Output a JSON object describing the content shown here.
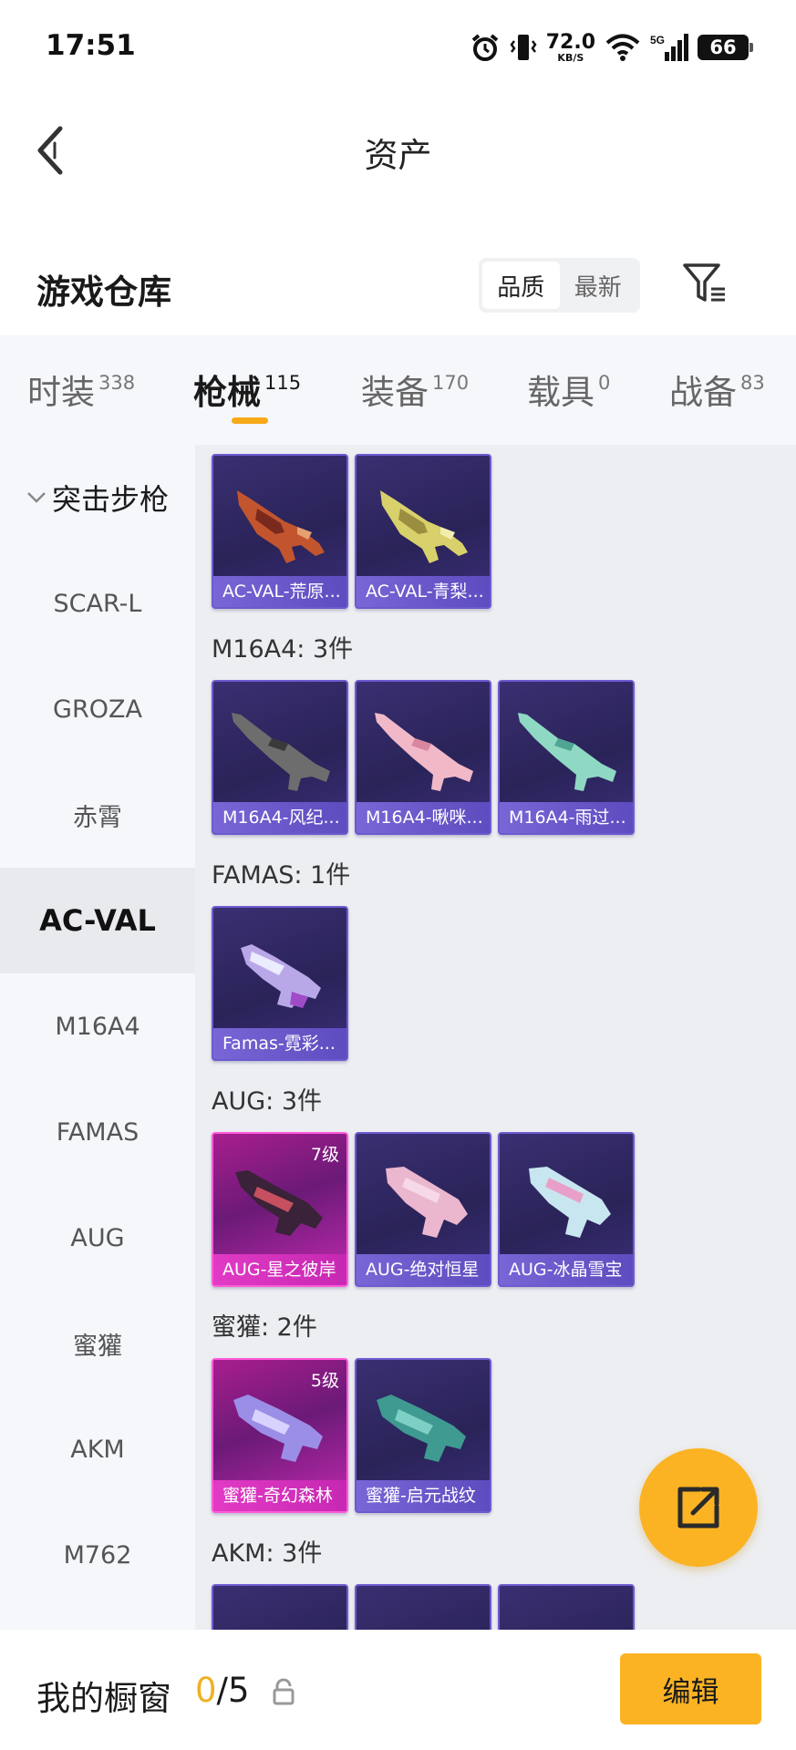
{
  "status_bar": {
    "time": "17:51",
    "net_speed": "72.0",
    "net_unit": "KB/S",
    "signal_label": "5G",
    "battery": "66"
  },
  "header": {
    "title": "资产"
  },
  "warehouse": {
    "title": "游戏仓库",
    "sort_options": [
      "品质",
      "最新"
    ],
    "active_sort": "品质"
  },
  "tabs": [
    {
      "label": "时装",
      "count": "338"
    },
    {
      "label": "枪械",
      "count": "115"
    },
    {
      "label": "装备",
      "count": "170"
    },
    {
      "label": "载具",
      "count": "0"
    },
    {
      "label": "战备",
      "count": "83"
    }
  ],
  "active_tab": "枪械",
  "sidebar": {
    "group": "突击步枪",
    "items": [
      "SCAR-L",
      "GROZA",
      "赤霄",
      "AC-VAL",
      "M16A4",
      "FAMAS",
      "AUG",
      "蜜獾",
      "AKM",
      "M762"
    ],
    "active": "AC-VAL"
  },
  "content": {
    "groups": [
      {
        "label": "",
        "items": [
          {
            "name": "AC-VAL-荒原...",
            "level": ""
          },
          {
            "name": "AC-VAL-青梨...",
            "level": ""
          }
        ]
      },
      {
        "label": "M16A4: 3件",
        "items": [
          {
            "name": "M16A4-风纪...",
            "level": ""
          },
          {
            "name": "M16A4-啾咪...",
            "level": ""
          },
          {
            "name": "M16A4-雨过...",
            "level": ""
          }
        ]
      },
      {
        "label": "FAMAS: 1件",
        "items": [
          {
            "name": "Famas-霓彩...",
            "level": ""
          }
        ]
      },
      {
        "label": "AUG: 3件",
        "items": [
          {
            "name": "AUG-星之彼岸",
            "level": "7级"
          },
          {
            "name": "AUG-绝对恒星",
            "level": ""
          },
          {
            "name": "AUG-冰晶雪宝",
            "level": ""
          }
        ]
      },
      {
        "label": "蜜獾: 2件",
        "items": [
          {
            "name": "蜜獾-奇幻森林",
            "level": "5级"
          },
          {
            "name": "蜜獾-启元战纹",
            "level": ""
          }
        ]
      },
      {
        "label": "AKM: 3件",
        "items": []
      }
    ]
  },
  "bottom": {
    "showcase_label": "我的橱窗",
    "showcase_current": "0",
    "showcase_total": "/5",
    "edit_label": "编辑"
  },
  "colors": {
    "accent": "#fbb324",
    "card_purple": "#2a2358",
    "card_pink": "#a81e8f",
    "tab_indicator": "#f7a91a"
  },
  "icons": [
    "alarm-icon",
    "vibrate-icon",
    "wifi-icon",
    "signal-icon",
    "battery-icon",
    "back-arrow-icon",
    "filter-icon",
    "chevron-down-icon",
    "share-icon",
    "lock-icon"
  ]
}
